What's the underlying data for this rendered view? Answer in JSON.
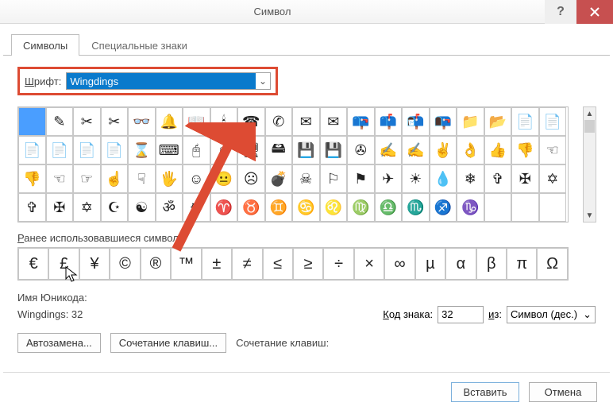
{
  "window": {
    "title": "Символ"
  },
  "tabs": [
    {
      "label": "Символы",
      "active": true
    },
    {
      "label": "Специальные знаки",
      "active": false
    }
  ],
  "font_row": {
    "label_prefix": "Ш",
    "label_rest": "рифт:",
    "value": "Wingdings"
  },
  "grid": [
    [
      "",
      "✎",
      "✂",
      "✂",
      "👓",
      "🔔",
      "📖",
      "🕯",
      "☎",
      "✆",
      "✉",
      "✉",
      "📪",
      "📫",
      "📬",
      "📭",
      "📁",
      "📂",
      "📄",
      "📄"
    ],
    [
      "📄",
      "📄",
      "📄",
      "📄",
      "⌛",
      "⌨",
      "🖰",
      "🖰",
      "🖥",
      "🖴",
      "💾",
      "💾",
      "✇",
      "✍",
      "✍",
      "✌",
      "👌",
      "👍",
      "👎",
      "☜"
    ],
    [
      "👎",
      "☜",
      "☞",
      "☝",
      "☟",
      "🖐",
      "☺",
      "😐",
      "☹",
      "💣",
      "☠",
      "⚐",
      "⚑",
      "✈",
      "☀",
      "💧",
      "❄",
      "✞",
      "✠",
      "✡"
    ],
    [
      "✞",
      "✠",
      "✡",
      "☪",
      "☯",
      "ॐ",
      "☸",
      "♈",
      "♉",
      "♊",
      "♋",
      "♌",
      "♍",
      "♎",
      "♏",
      "♐",
      "♑",
      " ",
      " ",
      " "
    ]
  ],
  "grid_selected": [
    0,
    0
  ],
  "recent_label_prefix": "Р",
  "recent_label_rest": "анее использовавшиеся символь",
  "recent": [
    "€",
    "£",
    "¥",
    "©",
    "®",
    "™",
    "±",
    "≠",
    "≤",
    "≥",
    "÷",
    "×",
    "∞",
    "µ",
    "α",
    "β",
    "π",
    "Ω"
  ],
  "meta": {
    "name_label": "Имя Юникода:",
    "name_value": "Wingdings: 32",
    "code_label_prefix": "К",
    "code_label_rest": "од знака:",
    "code_value": "32",
    "from_label_prefix": "и",
    "from_label_rest": "з:",
    "from_value": "Символ (дес.)"
  },
  "buttons": {
    "autocorrect": "Автозамена...",
    "shortcut": "Сочетание клавиш...",
    "shortcut_label": "Сочетание клавиш:",
    "insert": "Вставить",
    "cancel": "Отмена"
  }
}
